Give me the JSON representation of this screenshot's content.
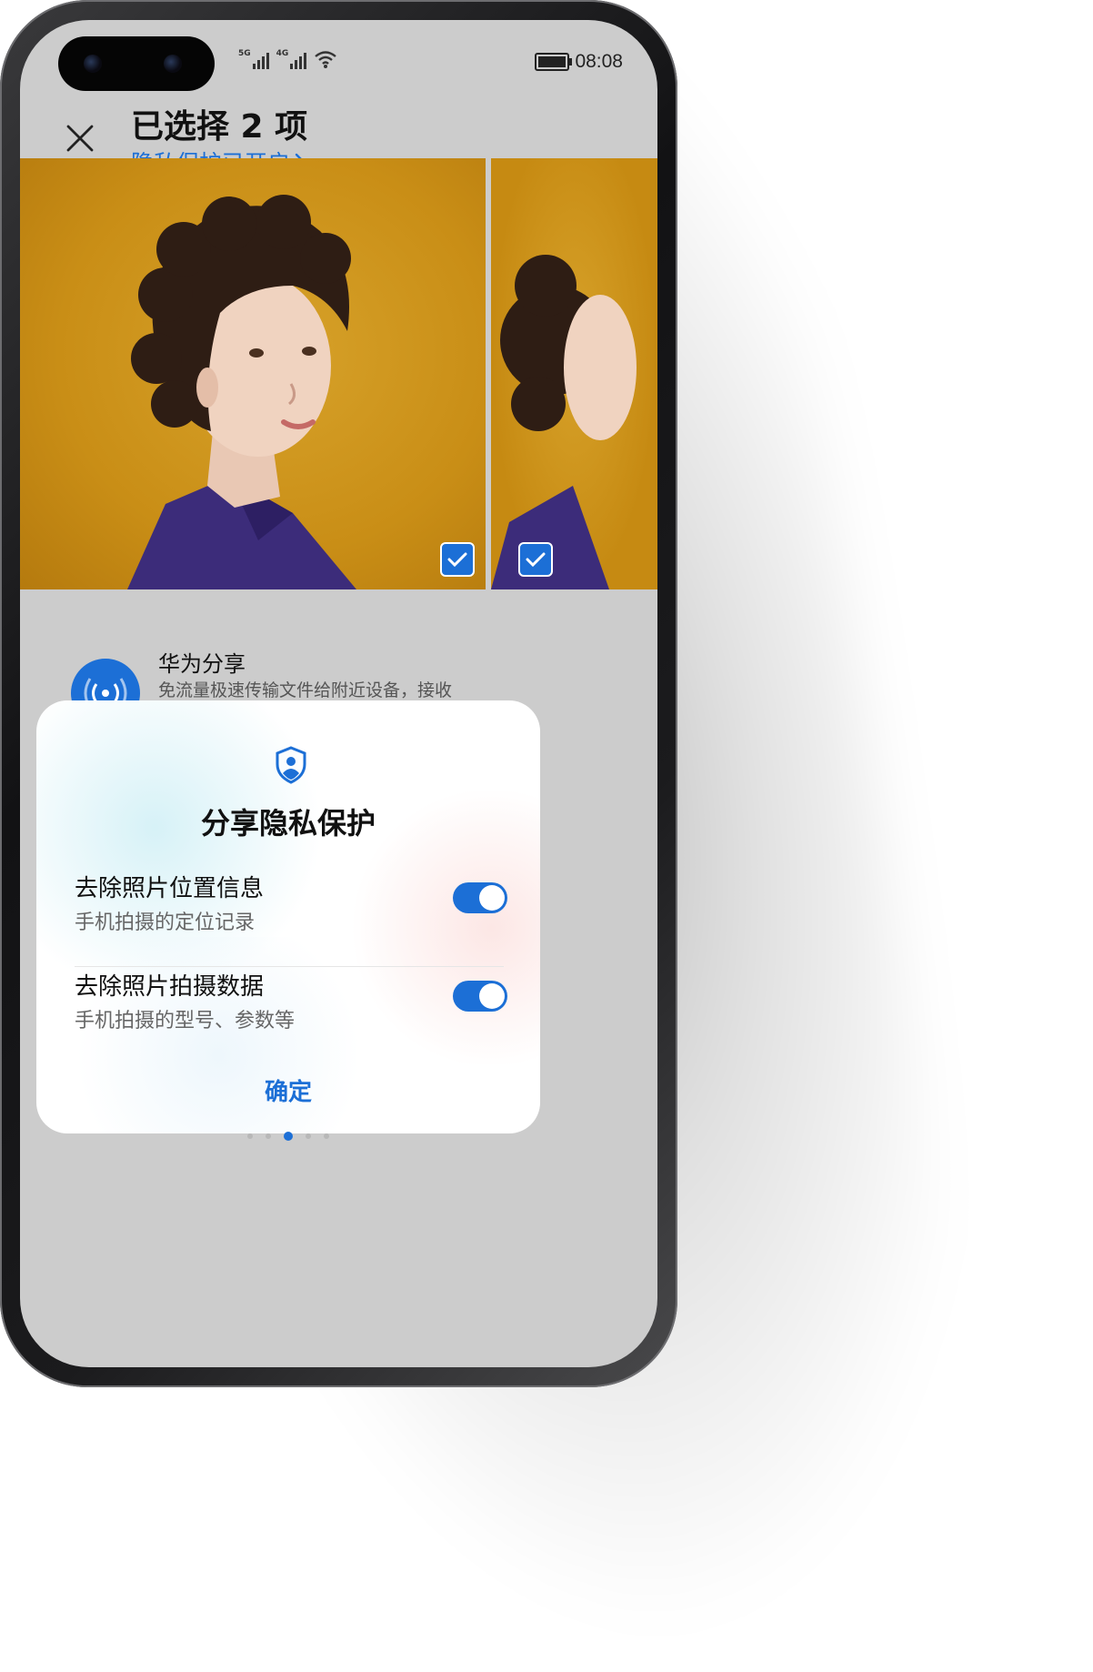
{
  "status_bar": {
    "signal_1_label": "5G",
    "signal_2_label": "4G",
    "time": "08:08"
  },
  "header": {
    "title": "已选择 2 项",
    "privacy_link": "隐私保护已开启"
  },
  "photos": {
    "selected_count": 2
  },
  "share": {
    "title": "华为分享",
    "description": "免流量极速传输文件给附近设备，接收"
  },
  "dialog": {
    "title": "分享隐私保护",
    "options": [
      {
        "title": "去除照片位置信息",
        "description": "手机拍摄的定位记录",
        "enabled": true
      },
      {
        "title": "去除照片拍摄数据",
        "description": "手机拍摄的型号、参数等",
        "enabled": true
      }
    ],
    "confirm_label": "确定"
  },
  "pagination": {
    "pages": 5,
    "active_index": 2
  },
  "colors": {
    "accent": "#1c6fd6",
    "photo_background": "#c98e16",
    "screen_background": "#cccccc"
  },
  "icons": {
    "close": "close-icon",
    "chevron": "chevron-right-icon",
    "share": "wireless-share-icon",
    "shield": "privacy-shield-icon",
    "check": "checkmark-icon"
  }
}
